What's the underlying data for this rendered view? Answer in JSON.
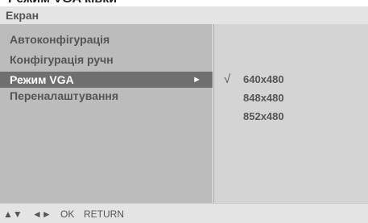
{
  "page": {
    "heading": "Режим VGA ківки"
  },
  "title_bar": {
    "title": "Екран"
  },
  "menu": {
    "items": [
      {
        "label": "Автоконфігурація",
        "selected": false
      },
      {
        "label": "Конфігурація ручн",
        "selected": false
      },
      {
        "label": "Режим VGA",
        "selected": true,
        "arrow": "►"
      },
      {
        "label": "Переналаштування",
        "selected": false
      }
    ]
  },
  "options": {
    "items": [
      {
        "value": "640x480",
        "checked": true,
        "check_mark": "√"
      },
      {
        "value": "848x480",
        "checked": false
      },
      {
        "value": "852x480",
        "checked": false
      }
    ]
  },
  "footer": {
    "updown": "▲▼",
    "leftright": "◄►",
    "ok": "OK",
    "return": "RETURN"
  }
}
